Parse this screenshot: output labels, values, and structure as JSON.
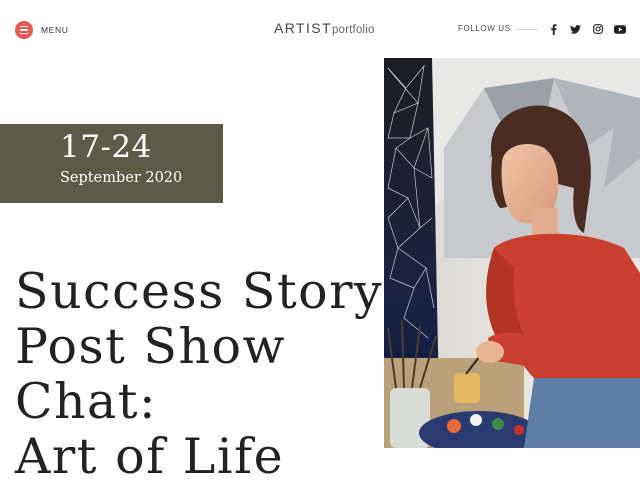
{
  "header": {
    "menu_label": "MENU",
    "logo_main": "ARTIST",
    "logo_sub": "portfolio",
    "follow_label": "FOLLOW US",
    "social_icons": [
      "facebook-icon",
      "twitter-icon",
      "instagram-icon",
      "youtube-icon"
    ]
  },
  "event": {
    "date_range": "17-24",
    "month_year": "September 2020"
  },
  "post": {
    "title_lines": [
      "Success Story",
      "Post Show",
      "Chat:",
      "Art of Life"
    ]
  },
  "colors": {
    "accent": "#e9584e",
    "date_block": "#5c5a48",
    "text": "#222222"
  }
}
